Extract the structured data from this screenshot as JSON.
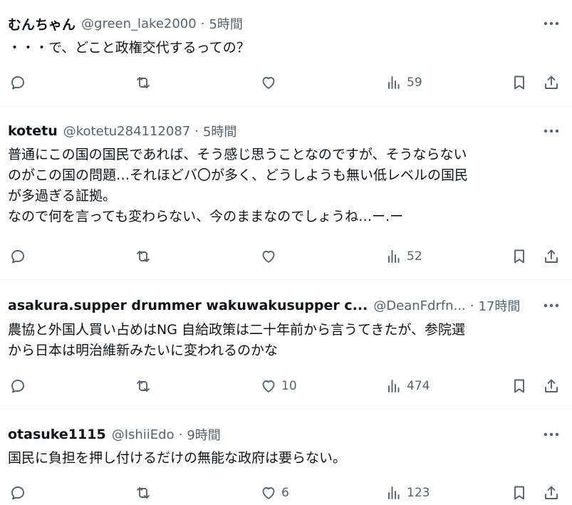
{
  "posts": [
    {
      "name": "むんちゃん",
      "handle": "@green_lake2000",
      "time": "5時間",
      "text": "・・・で、どこと政権交代するっての？",
      "likes": "",
      "views": "59"
    },
    {
      "name": "kotetu",
      "handle": "@kotetu284112087",
      "time": "5時間",
      "text": "普通にこの国の国民であれば、そう感じ思うことなのですが、そうならない\nのがこの国の問題…それほどバ〇が多く、どうしようも無い低レベルの国民\nが多過ぎる証拠。\nなので何を言っても変わらない、今のままなのでしょうね…ー.ー",
      "likes": "",
      "views": "52"
    },
    {
      "name": "asakura.supper drummer wakuwakusupper c...",
      "handle": "@DeanFdrfn...",
      "time": "17時間",
      "text": "農協と外国人買い占めはNG 自給政策は二十年前から言うてきたが、参院選\nから日本は明治維新みたいに変われるのかな",
      "likes": "10",
      "views": "474"
    },
    {
      "name": "otasuke1115",
      "handle": "@IshiiEdo",
      "time": "9時間",
      "text": "国民に負担を押し付けるだけの無能な政府は要らない。",
      "likes": "6",
      "views": "123"
    }
  ],
  "separator": "·"
}
